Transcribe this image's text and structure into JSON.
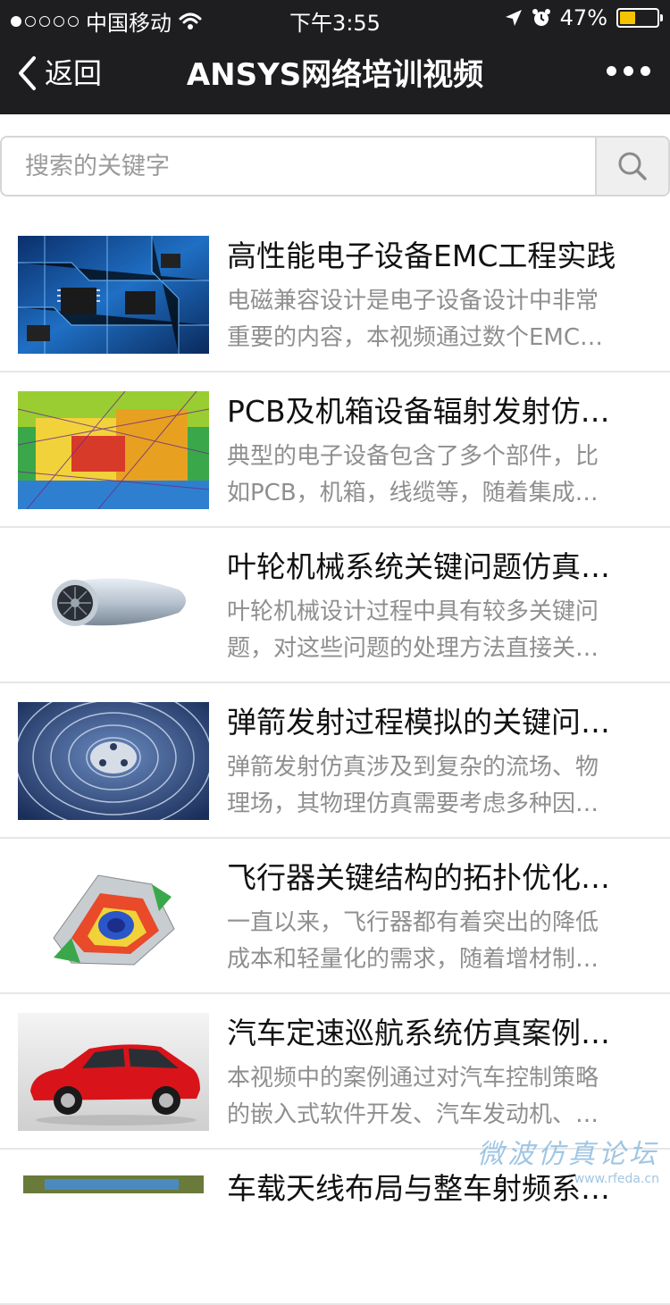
{
  "status_bar": {
    "carrier": "中国移动",
    "time": "下午3:55",
    "battery_percent": "47%",
    "battery_level": 0.47,
    "signal_bars_filled": 1,
    "signal_bars_total": 5,
    "icons": [
      "wifi-icon",
      "location-icon",
      "alarm-icon",
      "battery-icon"
    ],
    "battery_color": "#f5c400"
  },
  "navbar": {
    "back_label": "返回",
    "title": "ANSYS网络培训视频",
    "background": "#1e1e20"
  },
  "search": {
    "placeholder": "搜索的关键字",
    "value": ""
  },
  "items": [
    {
      "title": "高性能电子设备EMC工程实践",
      "desc_line1": "电磁兼容设计是电子设备设计中非常",
      "desc_line2": "重要的内容，本视频通过数个EMC…",
      "image": "circuit-board"
    },
    {
      "title": "PCB及机箱设备辐射发射仿…",
      "desc_line1": "典型的电子设备包含了多个部件，比",
      "desc_line2": "如PCB，机箱，线缆等，随着集成…",
      "image": "pcb-heatmap"
    },
    {
      "title": "叶轮机械系统关键问题仿真…",
      "desc_line1": "叶轮机械设计过程中具有较多关键问",
      "desc_line2": "题，对这些问题的处理方法直接关…",
      "image": "jet-engine"
    },
    {
      "title": "弹箭发射过程模拟的关键问…",
      "desc_line1": "弹箭发射仿真涉及到复杂的流场、物",
      "desc_line2": "理场，其物理仿真需要考虑多种因…",
      "image": "fan-grill"
    },
    {
      "title": "飞行器关键结构的拓扑优化…",
      "desc_line1": "一直以来，飞行器都有着突出的降低",
      "desc_line2": "成本和轻量化的需求，随着增材制…",
      "image": "topology-part"
    },
    {
      "title": "汽车定速巡航系统仿真案例…",
      "desc_line1": "本视频中的案例通过对汽车控制策略",
      "desc_line2": "的嵌入式软件开发、汽车发动机、…",
      "image": "red-car"
    },
    {
      "title": "车载天线布局与整车射频系…",
      "desc_line1": "",
      "desc_line2": "",
      "image": "antenna-vehicle"
    }
  ],
  "watermark": {
    "text": "微波仿真论坛",
    "url": "www.rfeda.cn"
  }
}
